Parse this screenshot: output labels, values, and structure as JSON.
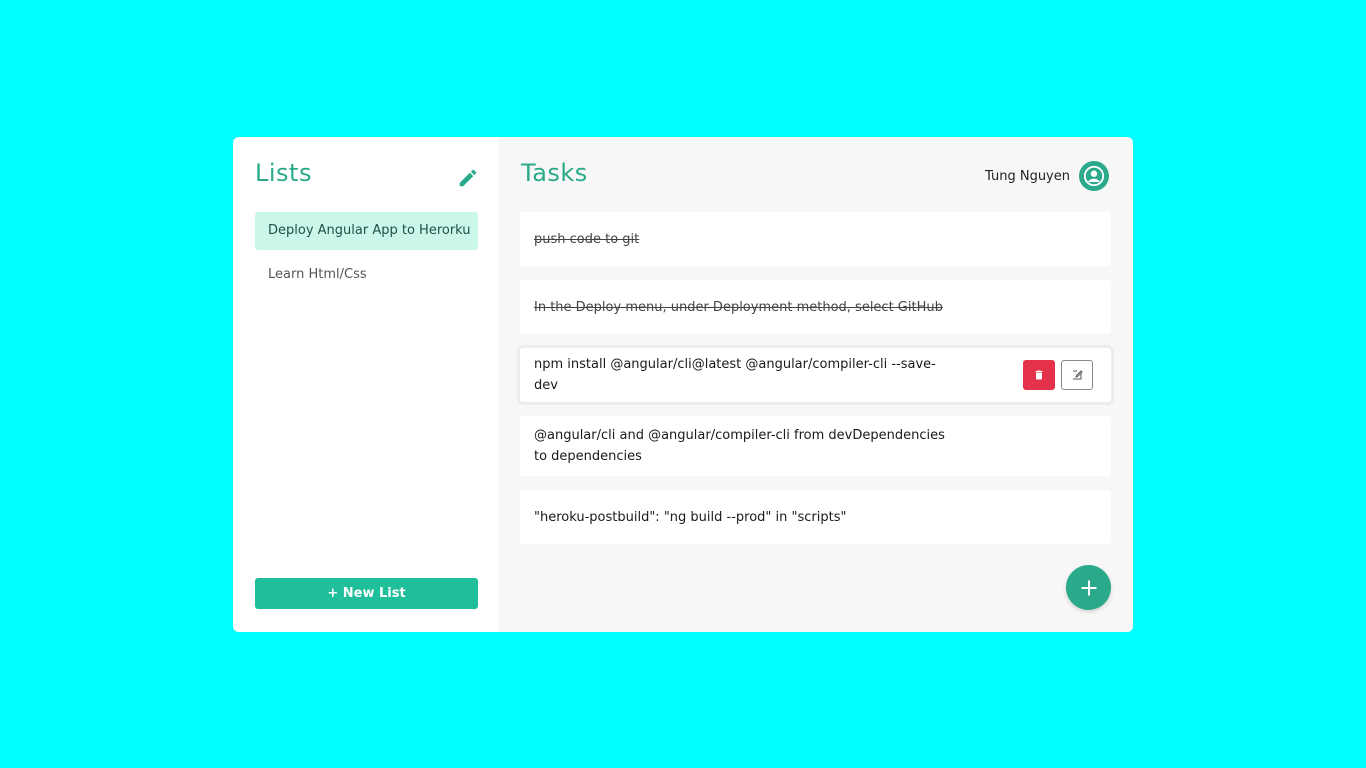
{
  "sidebar": {
    "title": "Lists",
    "edit_icon": "pencil-icon",
    "lists": [
      {
        "label": "Deploy Angular App to Herorku",
        "active": true
      },
      {
        "label": "Learn Html/Css",
        "active": false
      }
    ],
    "new_list_label": "+ New List"
  },
  "main": {
    "title": "Tasks",
    "user_name": "Tung Nguyen",
    "avatar_icon": "user-icon",
    "tasks": [
      {
        "text": "push code to git",
        "done": true
      },
      {
        "text": "In the Deploy menu, under Deployment method, select GitHub",
        "done": true
      },
      {
        "text": "npm install @angular/cli@latest @angular/compiler-cli --save-dev",
        "done": false
      },
      {
        "text": "@angular/cli and @angular/compiler-cli from devDependencies to dependencies",
        "done": false
      },
      {
        "text": "\"heroku-postbuild\": \"ng build --prod\" in \"scripts\"",
        "done": false
      }
    ],
    "delete_icon": "trash-icon",
    "edit_task_icon": "edit-icon",
    "add_icon": "plus-icon"
  },
  "colors": {
    "background": "#00ffff",
    "accent": "#2aaa8a",
    "active_list": "#cbf7ea",
    "new_list_button": "#1fbf9b",
    "delete": "#e3324a"
  }
}
